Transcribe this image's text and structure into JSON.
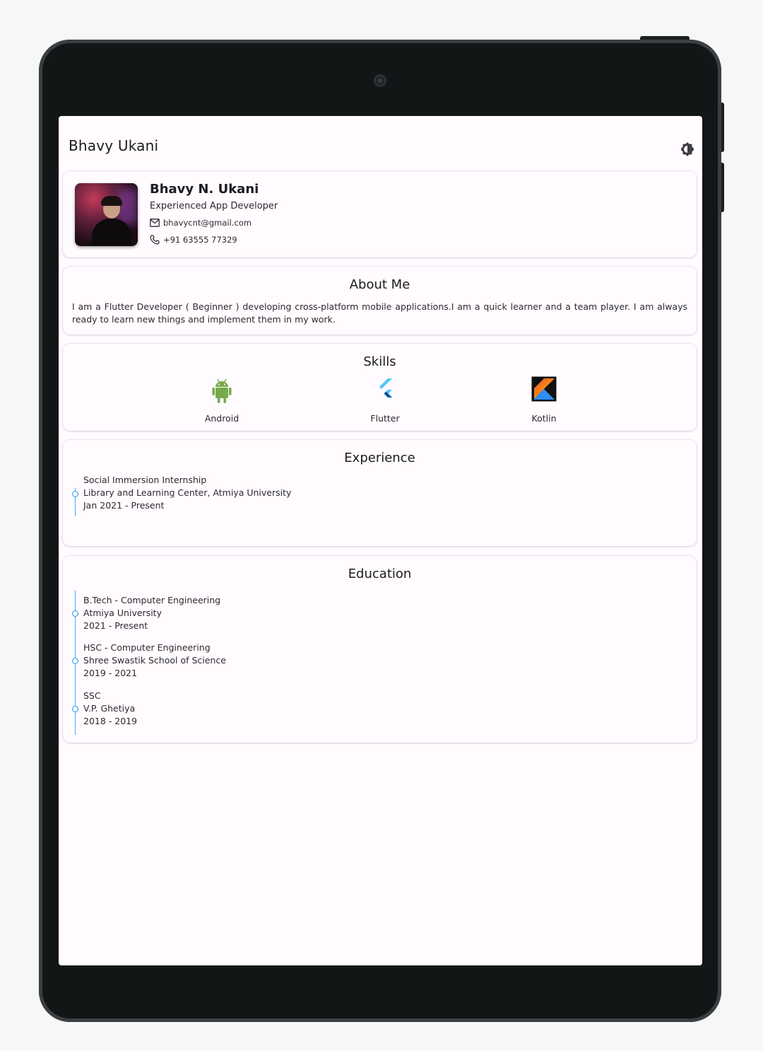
{
  "app": {
    "title": "Bhavy Ukani"
  },
  "profile": {
    "name": "Bhavy N. Ukani",
    "role": "Experienced App Developer",
    "email": "bhavycnt@gmail.com",
    "phone": "+91 63555 77329"
  },
  "about": {
    "title": "About Me",
    "text": "I am a Flutter Developer ( Beginner ) developing cross-platform mobile applications.I am a quick learner and a team player. I am always ready to learn new things and implement them in my work."
  },
  "skills": {
    "title": "Skills",
    "items": [
      {
        "label": "Android",
        "icon": "android-icon"
      },
      {
        "label": "Flutter",
        "icon": "flutter-icon"
      },
      {
        "label": "Kotlin",
        "icon": "kotlin-icon"
      }
    ]
  },
  "experience": {
    "title": "Experience",
    "items": [
      {
        "line1": "Social Immersion Internship",
        "line2": "Library and Learning Center, Atmiya University",
        "line3": "Jan 2021 - Present"
      }
    ]
  },
  "education": {
    "title": "Education",
    "items": [
      {
        "line1": "B.Tech - Computer Engineering",
        "line2": "Atmiya University",
        "line3": "2021 - Present"
      },
      {
        "line1": "HSC - Computer Engineering",
        "line2": "Shree Swastik School of Science",
        "line3": "2019 - 2021"
      },
      {
        "line1": "SSC",
        "line2": "V.P. Ghetiya",
        "line3": "2018 - 2019"
      }
    ]
  },
  "colors": {
    "timeline": "#2196f3",
    "background": "#fffbfe",
    "device": "#121617"
  }
}
